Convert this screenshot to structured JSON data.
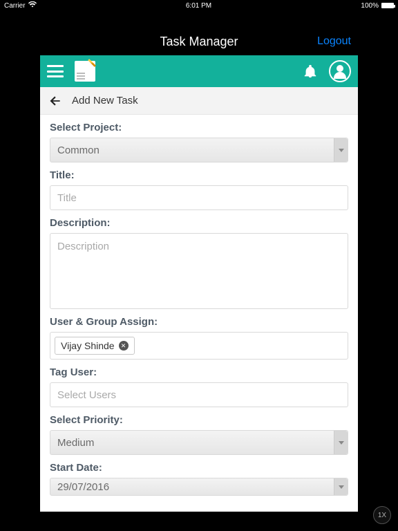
{
  "statusbar": {
    "carrier": "Carrier",
    "time": "6:01 PM",
    "battery": "100%"
  },
  "titlebar": {
    "title": "Task Manager",
    "logout": "Logout"
  },
  "breadcrumb": {
    "page_title": "Add New Task"
  },
  "form": {
    "project": {
      "label": "Select Project:",
      "value": "Common"
    },
    "title": {
      "label": "Title:",
      "placeholder": "Title",
      "value": ""
    },
    "description": {
      "label": "Description:",
      "placeholder": "Description",
      "value": ""
    },
    "assign": {
      "label": "User & Group Assign:",
      "chips": [
        {
          "name": "Vijay Shinde"
        }
      ]
    },
    "tag_user": {
      "label": "Tag User:",
      "placeholder": "Select Users"
    },
    "priority": {
      "label": "Select Priority:",
      "value": "Medium"
    },
    "start_date": {
      "label": "Start Date:",
      "value": "29/07/2016"
    }
  },
  "badge": {
    "zoom": "1X"
  }
}
